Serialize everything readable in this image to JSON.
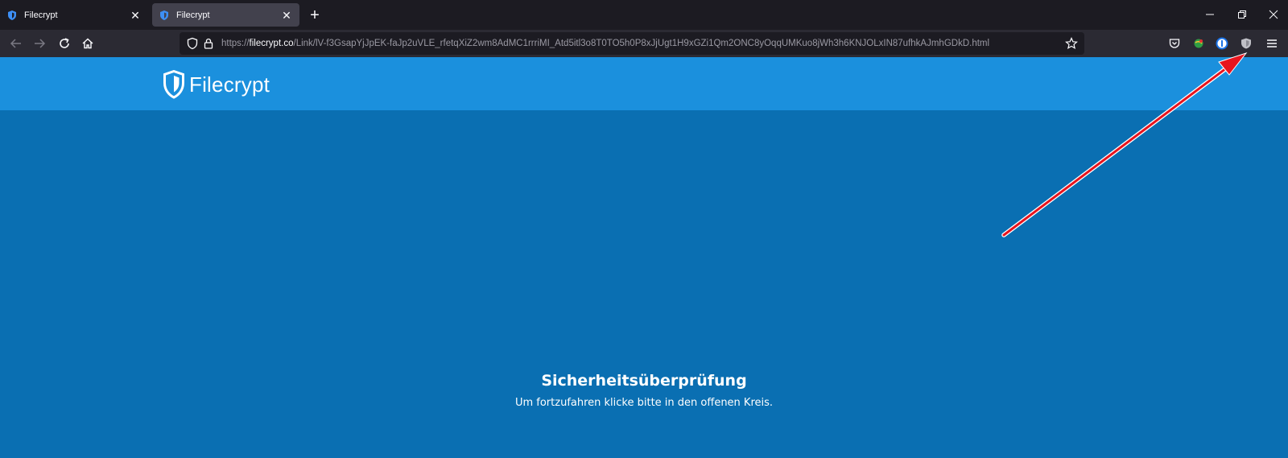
{
  "browser": {
    "tabs": [
      {
        "title": "Filecrypt",
        "active": false
      },
      {
        "title": "Filecrypt",
        "active": true
      }
    ],
    "url": {
      "scheme": "https://",
      "host": "filecrypt.co",
      "path": "/Link/lV-f3GsapYjJpEK-faJp2uVLE_rfetqXiZ2wm8AdMC1rrriMI_Atd5itl3o8T0TO5h0P8xJjUgt1H9xGZi1Qm2ONC8yOqqUMKuo8jWh3h6KNJOLxIN87ufhkAJmhGDkD.html"
    }
  },
  "site": {
    "logo_text": "Filecrypt"
  },
  "page": {
    "heading": "Sicherheitsüberprüfung",
    "subtext": "Um fortzufahren klicke bitte in den offenen Kreis."
  },
  "colors": {
    "header_blue": "#1b90dd",
    "content_blue": "#0a6fb2",
    "arrow_red": "#e8141e"
  }
}
